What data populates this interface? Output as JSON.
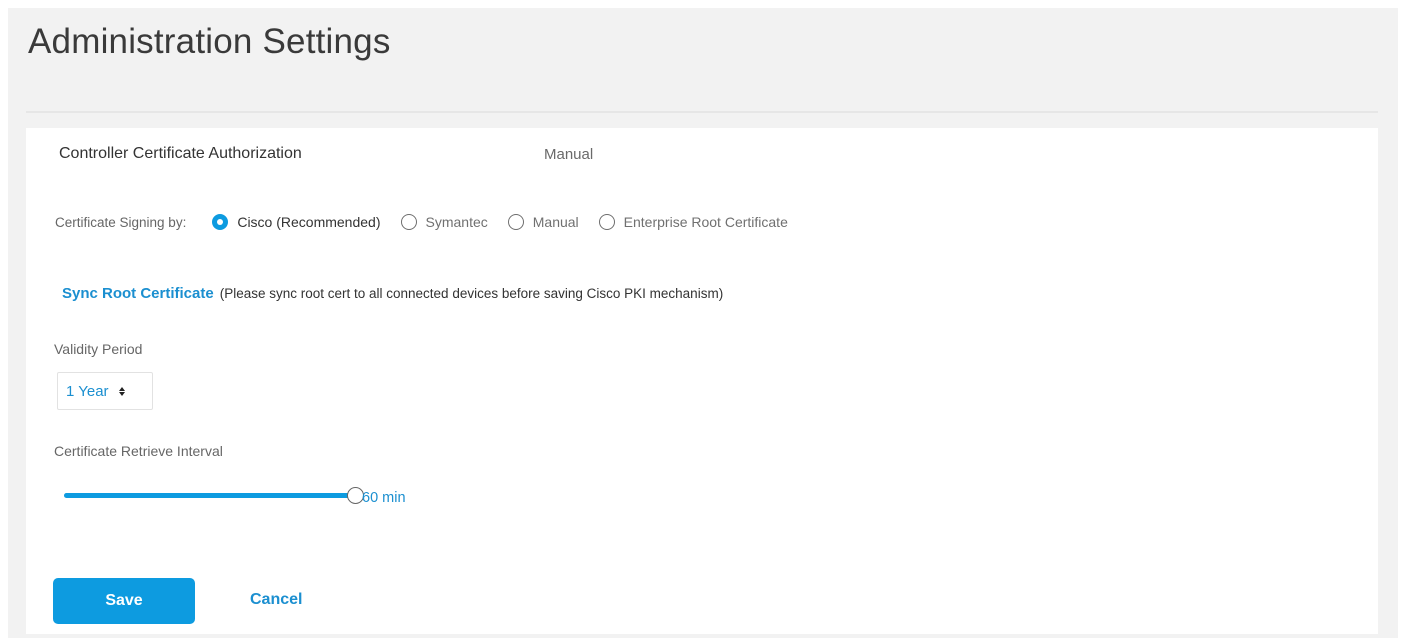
{
  "page": {
    "title": "Administration Settings"
  },
  "section": {
    "label": "Controller Certificate Authorization",
    "value": "Manual"
  },
  "signing": {
    "label": "Certificate Signing by:",
    "options": [
      {
        "label": "Cisco (Recommended)",
        "checked": true
      },
      {
        "label": "Symantec",
        "checked": false
      },
      {
        "label": "Manual",
        "checked": false
      },
      {
        "label": "Enterprise Root Certificate",
        "checked": false
      }
    ]
  },
  "sync": {
    "link_label": "Sync Root Certificate",
    "note": "(Please sync root cert to all connected devices before saving Cisco PKI mechanism)"
  },
  "validity": {
    "label": "Validity Period",
    "selected": "1 Year"
  },
  "interval": {
    "label": "Certificate Retrieve Interval",
    "value_label": "60 min",
    "fraction": 1.0
  },
  "actions": {
    "save_label": "Save",
    "cancel_label": "Cancel"
  },
  "colors": {
    "accent": "#0d9be0",
    "link": "#1b8fd0",
    "background": "#f2f2f2",
    "card": "#ffffff"
  },
  "icons": {
    "select_caret": "sort-icon",
    "radio": "radio-icon"
  }
}
